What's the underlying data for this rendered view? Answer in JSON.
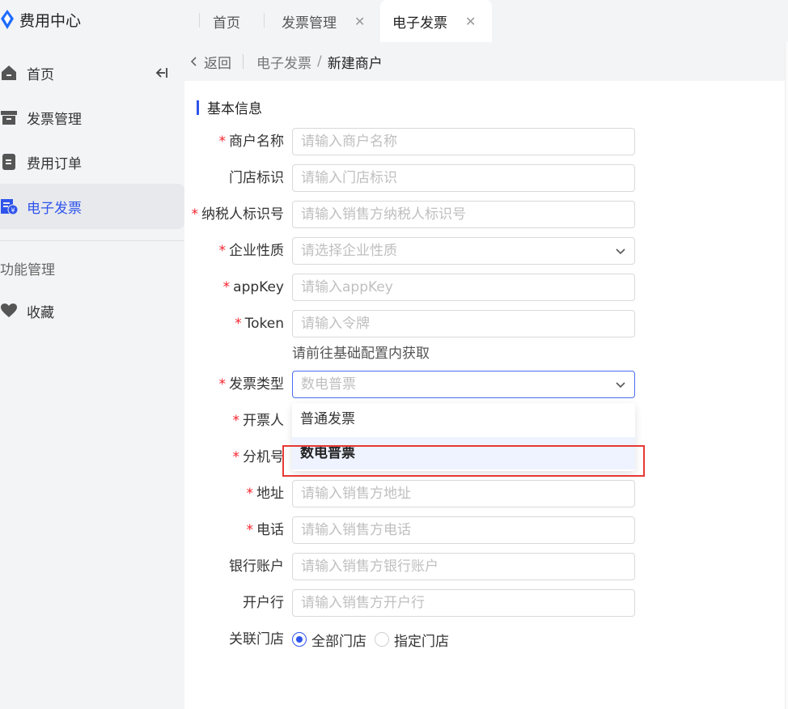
{
  "app": {
    "title": "费用中心"
  },
  "tabs": [
    {
      "label": "首页",
      "closable": false
    },
    {
      "label": "发票管理",
      "closable": true
    },
    {
      "label": "电子发票",
      "closable": true,
      "active": true
    }
  ],
  "sidebar": {
    "items": [
      {
        "label": "首页",
        "icon": "home-icon"
      },
      {
        "label": "发票管理",
        "icon": "archive-icon"
      },
      {
        "label": "费用订单",
        "icon": "document-icon"
      },
      {
        "label": "电子发票",
        "icon": "e-invoice-icon",
        "active": true
      }
    ],
    "section_label": "功能管理",
    "favorites": {
      "label": "收藏",
      "icon": "heart-icon"
    }
  },
  "breadcrumb": {
    "back": "返回",
    "parent": "电子发票",
    "separator": "/",
    "current": "新建商户"
  },
  "form": {
    "section_title": "基本信息",
    "merchant_name": {
      "label": "商户名称",
      "required": true,
      "placeholder": "请输入商户名称"
    },
    "store_id": {
      "label": "门店标识",
      "required": false,
      "placeholder": "请输入门店标识"
    },
    "taxpayer_id": {
      "label": "纳税人标识号",
      "required": true,
      "placeholder": "请输入销售方纳税人标识号"
    },
    "enterprise_type": {
      "label": "企业性质",
      "required": true,
      "placeholder": "请选择企业性质"
    },
    "app_key": {
      "label": "appKey",
      "required": true,
      "placeholder": "请输入appKey"
    },
    "token": {
      "label": "Token",
      "required": true,
      "placeholder": "请输入令牌",
      "helper": "请前往基础配置内获取"
    },
    "invoice_type": {
      "label": "发票类型",
      "required": true,
      "value": "数电普票"
    },
    "issuer": {
      "label": "开票人",
      "required": true
    },
    "extension": {
      "label": "分机号",
      "required": true
    },
    "address": {
      "label": "地址",
      "required": true,
      "placeholder": "请输入销售方地址"
    },
    "phone": {
      "label": "电话",
      "required": true,
      "placeholder": "请输入销售方电话"
    },
    "bank_account": {
      "label": "银行账户",
      "required": false,
      "placeholder": "请输入销售方银行账户"
    },
    "bank": {
      "label": "开户行",
      "required": false,
      "placeholder": "请输入销售方开户行"
    },
    "linked_store": {
      "label": "关联门店",
      "options": [
        "全部门店",
        "指定门店"
      ],
      "selected": "全部门店"
    }
  },
  "invoice_dropdown": {
    "options": [
      "普通发票",
      "数电普票"
    ],
    "selected": "数电普票"
  },
  "colors": {
    "accent": "#2f54eb",
    "required": "#f5222d",
    "highlight_border": "#e53935"
  }
}
